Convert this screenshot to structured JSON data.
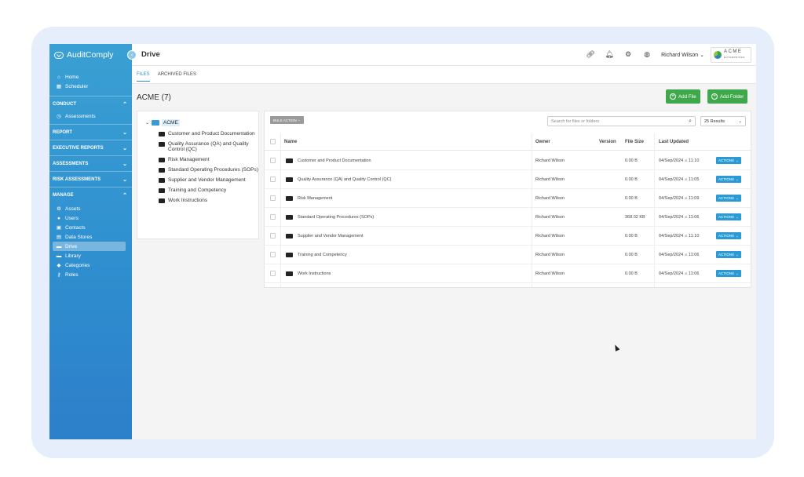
{
  "brand": {
    "name": "AuditComply"
  },
  "header": {
    "title": "Drive",
    "user": "Richard Wilson",
    "logo_text": "ACME",
    "logo_sub": "ENTERPRISES"
  },
  "sidebar": {
    "top_items": [
      {
        "label": "Home",
        "icon": "home-icon"
      },
      {
        "label": "Scheduler",
        "icon": "calendar-icon"
      }
    ],
    "sections": {
      "conduct": "CONDUCT",
      "report": "REPORT",
      "executive": "EXECUTIVE REPORTS",
      "assessments": "ASSESSMENTS",
      "risk": "RISK ASSESSMENTS",
      "manage": "MANAGE"
    },
    "conduct_items": [
      {
        "label": "Assessments",
        "icon": "clock-icon"
      }
    ],
    "manage_items": [
      {
        "label": "Assets",
        "icon": "gear-icon"
      },
      {
        "label": "Users",
        "icon": "user-icon"
      },
      {
        "label": "Contacts",
        "icon": "contacts-icon"
      },
      {
        "label": "Data Stores",
        "icon": "datastore-icon"
      },
      {
        "label": "Drive",
        "icon": "folder-icon"
      },
      {
        "label": "Library",
        "icon": "library-icon"
      },
      {
        "label": "Categories",
        "icon": "tag-icon"
      },
      {
        "label": "Roles",
        "icon": "key-icon"
      }
    ]
  },
  "tabs": [
    {
      "label": "FILES"
    },
    {
      "label": "ARCHIVED FILES"
    }
  ],
  "folder_title": "ACME (7)",
  "buttons": {
    "add_file": "Add File",
    "add_folder": "Add Folder",
    "bulk_action": "BULK ACTION",
    "actions": "ACTIONS"
  },
  "search": {
    "placeholder": "Search for files or folders"
  },
  "results": {
    "value": "25 Results"
  },
  "tree": {
    "root": "ACME",
    "items": [
      "Customer and Product Documentation",
      "Quality Assurance (QA) and Quality Control (QC)",
      "Risk Management",
      "Standard Operating Procedures (SOPs)",
      "Supplier and Vendor Management",
      "Training and Competency",
      "Work Instructions"
    ]
  },
  "table": {
    "columns": {
      "name": "Name",
      "owner": "Owner",
      "version": "Version",
      "size": "File Size",
      "updated": "Last Updated"
    },
    "rows": [
      {
        "name": "Customer and Product Documentation",
        "owner": "Richard Wilson",
        "size": "0.00 B",
        "date": "04/Sep/2024",
        "at": "at",
        "time": "11:10"
      },
      {
        "name": "Quality Assurance (QA) and Quality Control (QC)",
        "owner": "Richard Wilson",
        "size": "0.00 B",
        "date": "04/Sep/2024",
        "at": "at",
        "time": "11:05"
      },
      {
        "name": "Risk Management",
        "owner": "Richard Wilson",
        "size": "0.00 B",
        "date": "04/Sep/2024",
        "at": "at",
        "time": "11:09"
      },
      {
        "name": "Standard Operating Procedures (SOPs)",
        "owner": "Richard Wilson",
        "size": "368.02 KB",
        "date": "04/Sep/2024",
        "at": "at",
        "time": "11:06"
      },
      {
        "name": "Supplier and Vendor Management",
        "owner": "Richard Wilson",
        "size": "0.00 B",
        "date": "04/Sep/2024",
        "at": "at",
        "time": "11:10"
      },
      {
        "name": "Training and Competency",
        "owner": "Richard Wilson",
        "size": "0.00 B",
        "date": "04/Sep/2024",
        "at": "at",
        "time": "11:06"
      },
      {
        "name": "Work Instructions",
        "owner": "Richard Wilson",
        "size": "0.00 B",
        "date": "04/Sep/2024",
        "at": "at",
        "time": "11:06"
      }
    ]
  },
  "colors": {
    "accent": "#2a9ad6",
    "green": "#3ea84a",
    "sidebar": "#3399d1"
  }
}
